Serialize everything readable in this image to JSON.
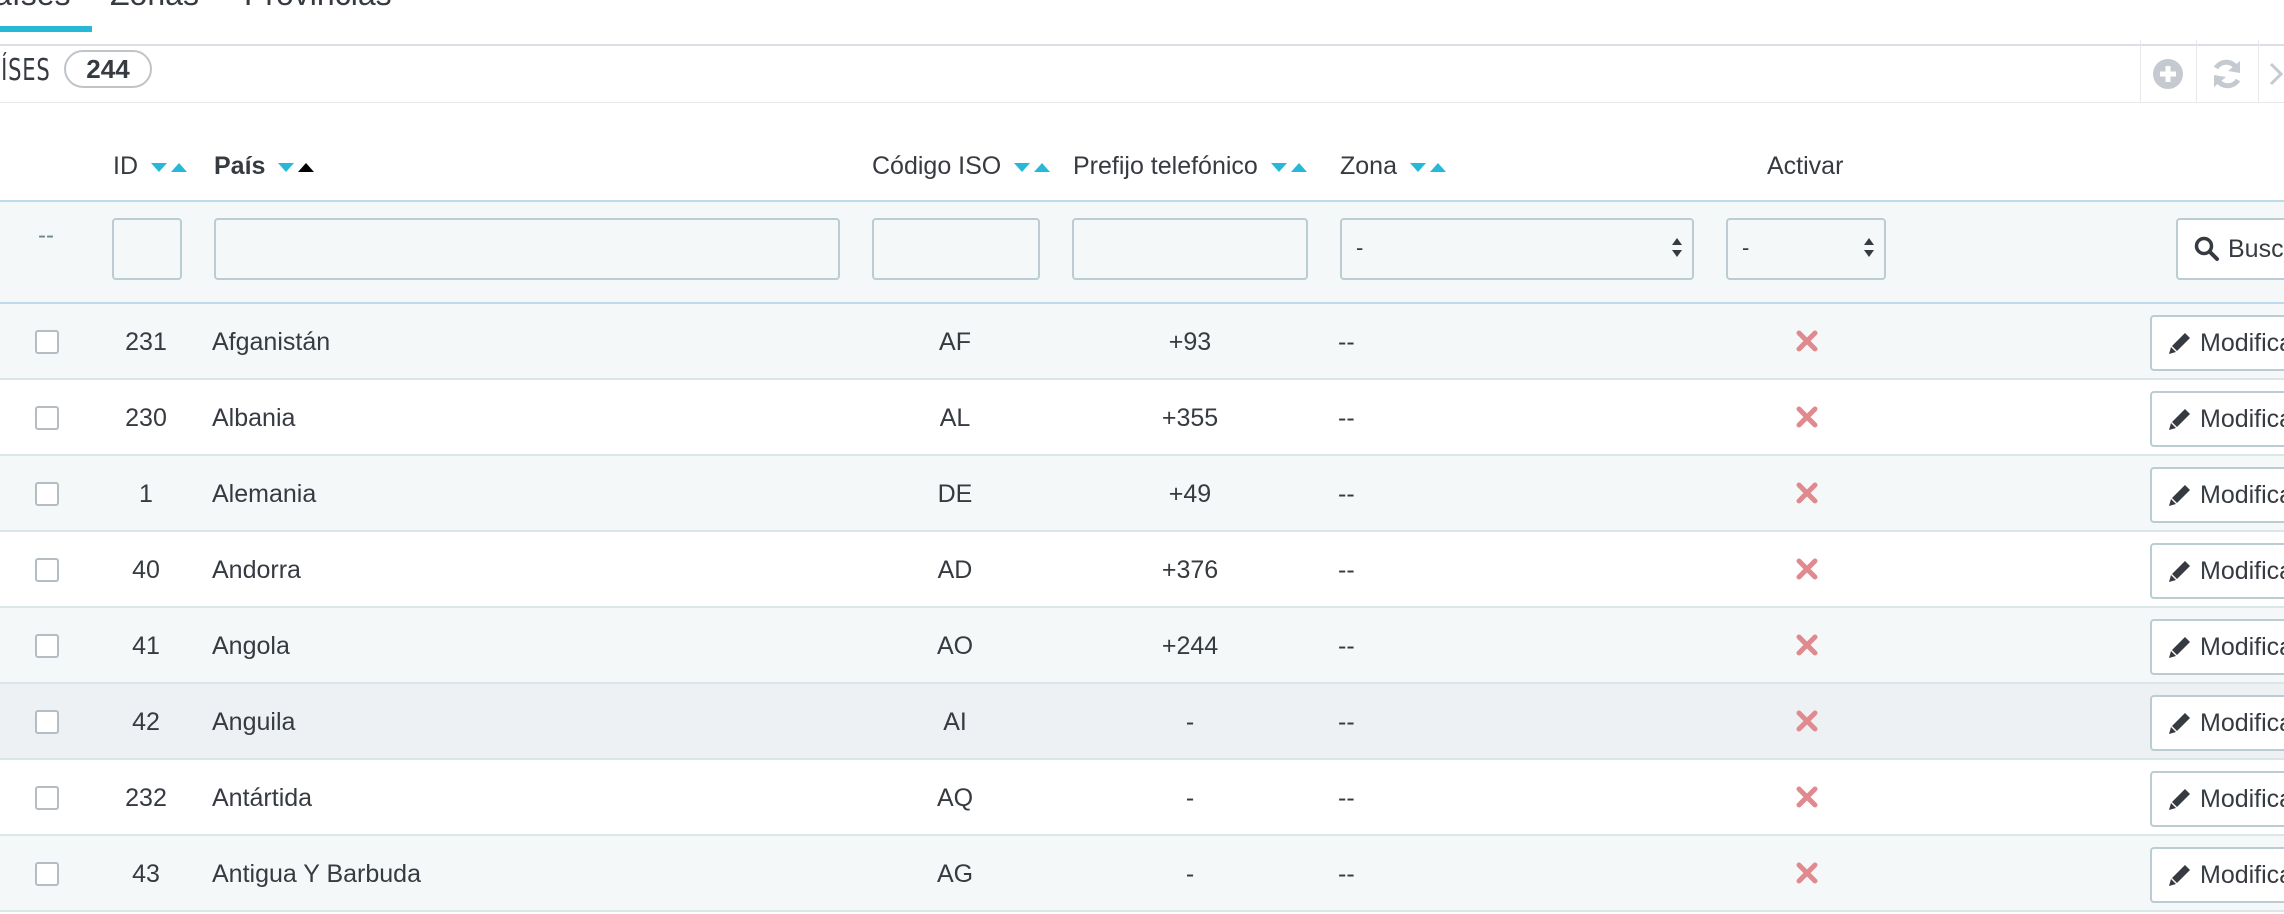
{
  "tabs": [
    {
      "label": "Países",
      "visible_text": "aíses",
      "active": true
    },
    {
      "label": "Zonas"
    },
    {
      "label": "Provincias"
    }
  ],
  "panel": {
    "title": "PAÍSES",
    "visible_title": "AÍSES",
    "count": "244"
  },
  "toolbar": {
    "icons": [
      "add-icon",
      "refresh-icon",
      "more-icon"
    ]
  },
  "columns": {
    "id": "ID",
    "country": "País",
    "iso": "Código ISO",
    "phone": "Prefijo telefónico",
    "zone": "Zona",
    "active": "Activar"
  },
  "filters": {
    "select_placeholder": "--",
    "zone_value": "-",
    "active_value": "-",
    "search_label": "Buscar",
    "search_visible": "Busca"
  },
  "edit_label": "Modificar",
  "edit_visible": "Modifica",
  "rows": [
    {
      "id": "231",
      "country": "Afganistán",
      "iso": "AF",
      "phone": "+93",
      "zone": "--",
      "active": false
    },
    {
      "id": "230",
      "country": "Albania",
      "iso": "AL",
      "phone": "+355",
      "zone": "--",
      "active": false
    },
    {
      "id": "1",
      "country": "Alemania",
      "iso": "DE",
      "phone": "+49",
      "zone": "--",
      "active": false
    },
    {
      "id": "40",
      "country": "Andorra",
      "iso": "AD",
      "phone": "+376",
      "zone": "--",
      "active": false
    },
    {
      "id": "41",
      "country": "Angola",
      "iso": "AO",
      "phone": "+244",
      "zone": "--",
      "active": false
    },
    {
      "id": "42",
      "country": "Anguila",
      "iso": "AI",
      "phone": "-",
      "zone": "--",
      "active": false
    },
    {
      "id": "232",
      "country": "Antártida",
      "iso": "AQ",
      "phone": "-",
      "zone": "--",
      "active": false
    },
    {
      "id": "43",
      "country": "Antigua Y Barbuda",
      "iso": "AG",
      "phone": "-",
      "zone": "--",
      "active": false
    }
  ],
  "colors": {
    "accent": "#25b9d7",
    "inactive_x": "#e08a8f",
    "text": "#363a41"
  }
}
